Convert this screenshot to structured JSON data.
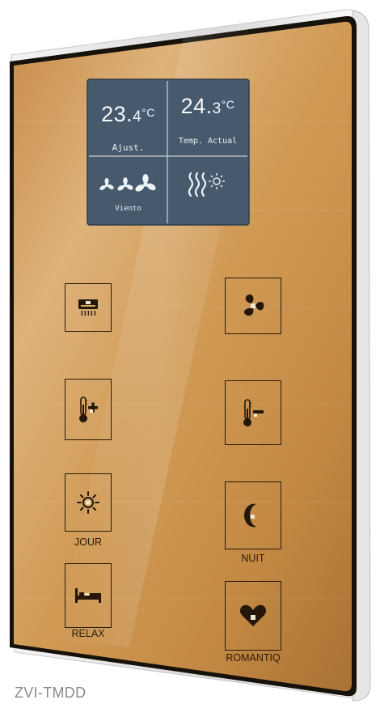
{
  "device": {
    "model": "ZVI-TMDD"
  },
  "display": {
    "setpoint": {
      "int": "23.",
      "dec": "4",
      "unit": "°C",
      "label": "Ajust."
    },
    "current": {
      "int": "24.",
      "dec": "3",
      "unit": "°C",
      "label": "Temp. Actual"
    },
    "fan_label": "Viento"
  },
  "buttons": {
    "jour": "JOUR",
    "nuit": "NUIT",
    "relax": "RELAX",
    "romantiq": "ROMANTIQ"
  },
  "colors": {
    "gold_light": "#d9a45f",
    "gold_dark": "#9a6a2c",
    "lcd": "#4b5e70",
    "frame": "#1a140e"
  }
}
